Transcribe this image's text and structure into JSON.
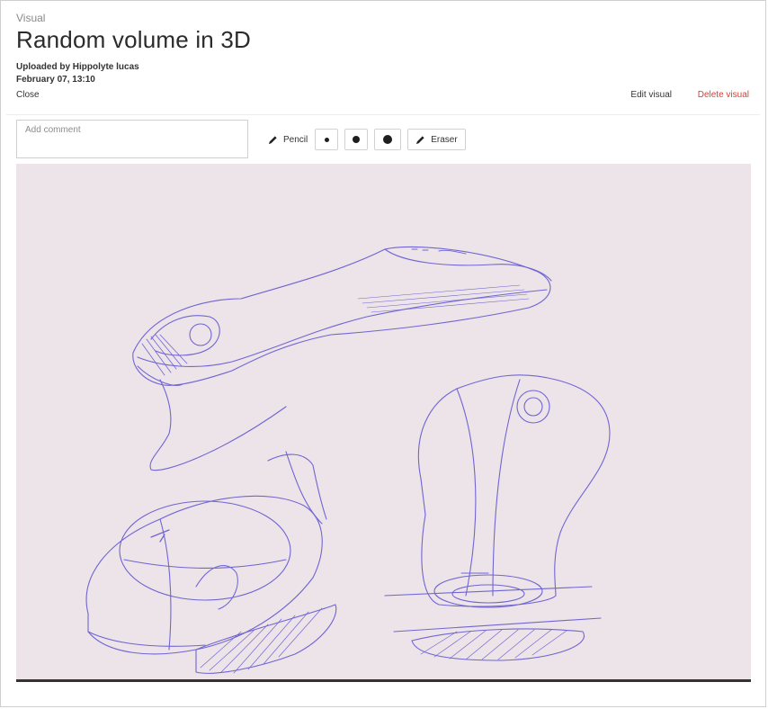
{
  "header": {
    "kicker": "Visual",
    "title": "Random volume in 3D",
    "uploaded_by": "Uploaded by Hippolyte lucas",
    "date": "February 07, 13:10",
    "close_label": "Close",
    "edit_label": "Edit visual",
    "delete_label": "Delete visual"
  },
  "comment": {
    "placeholder": "Add comment",
    "value": ""
  },
  "toolbar": {
    "pencil_label": "Pencil",
    "eraser_label": "Eraser",
    "brush_sizes": [
      "small",
      "medium",
      "large"
    ]
  },
  "colors": {
    "delete": "#e23b2e",
    "paper": "#ece4e8",
    "ink": "#5b4fd0"
  },
  "icons": [
    "pencil-icon",
    "eraser-icon"
  ]
}
